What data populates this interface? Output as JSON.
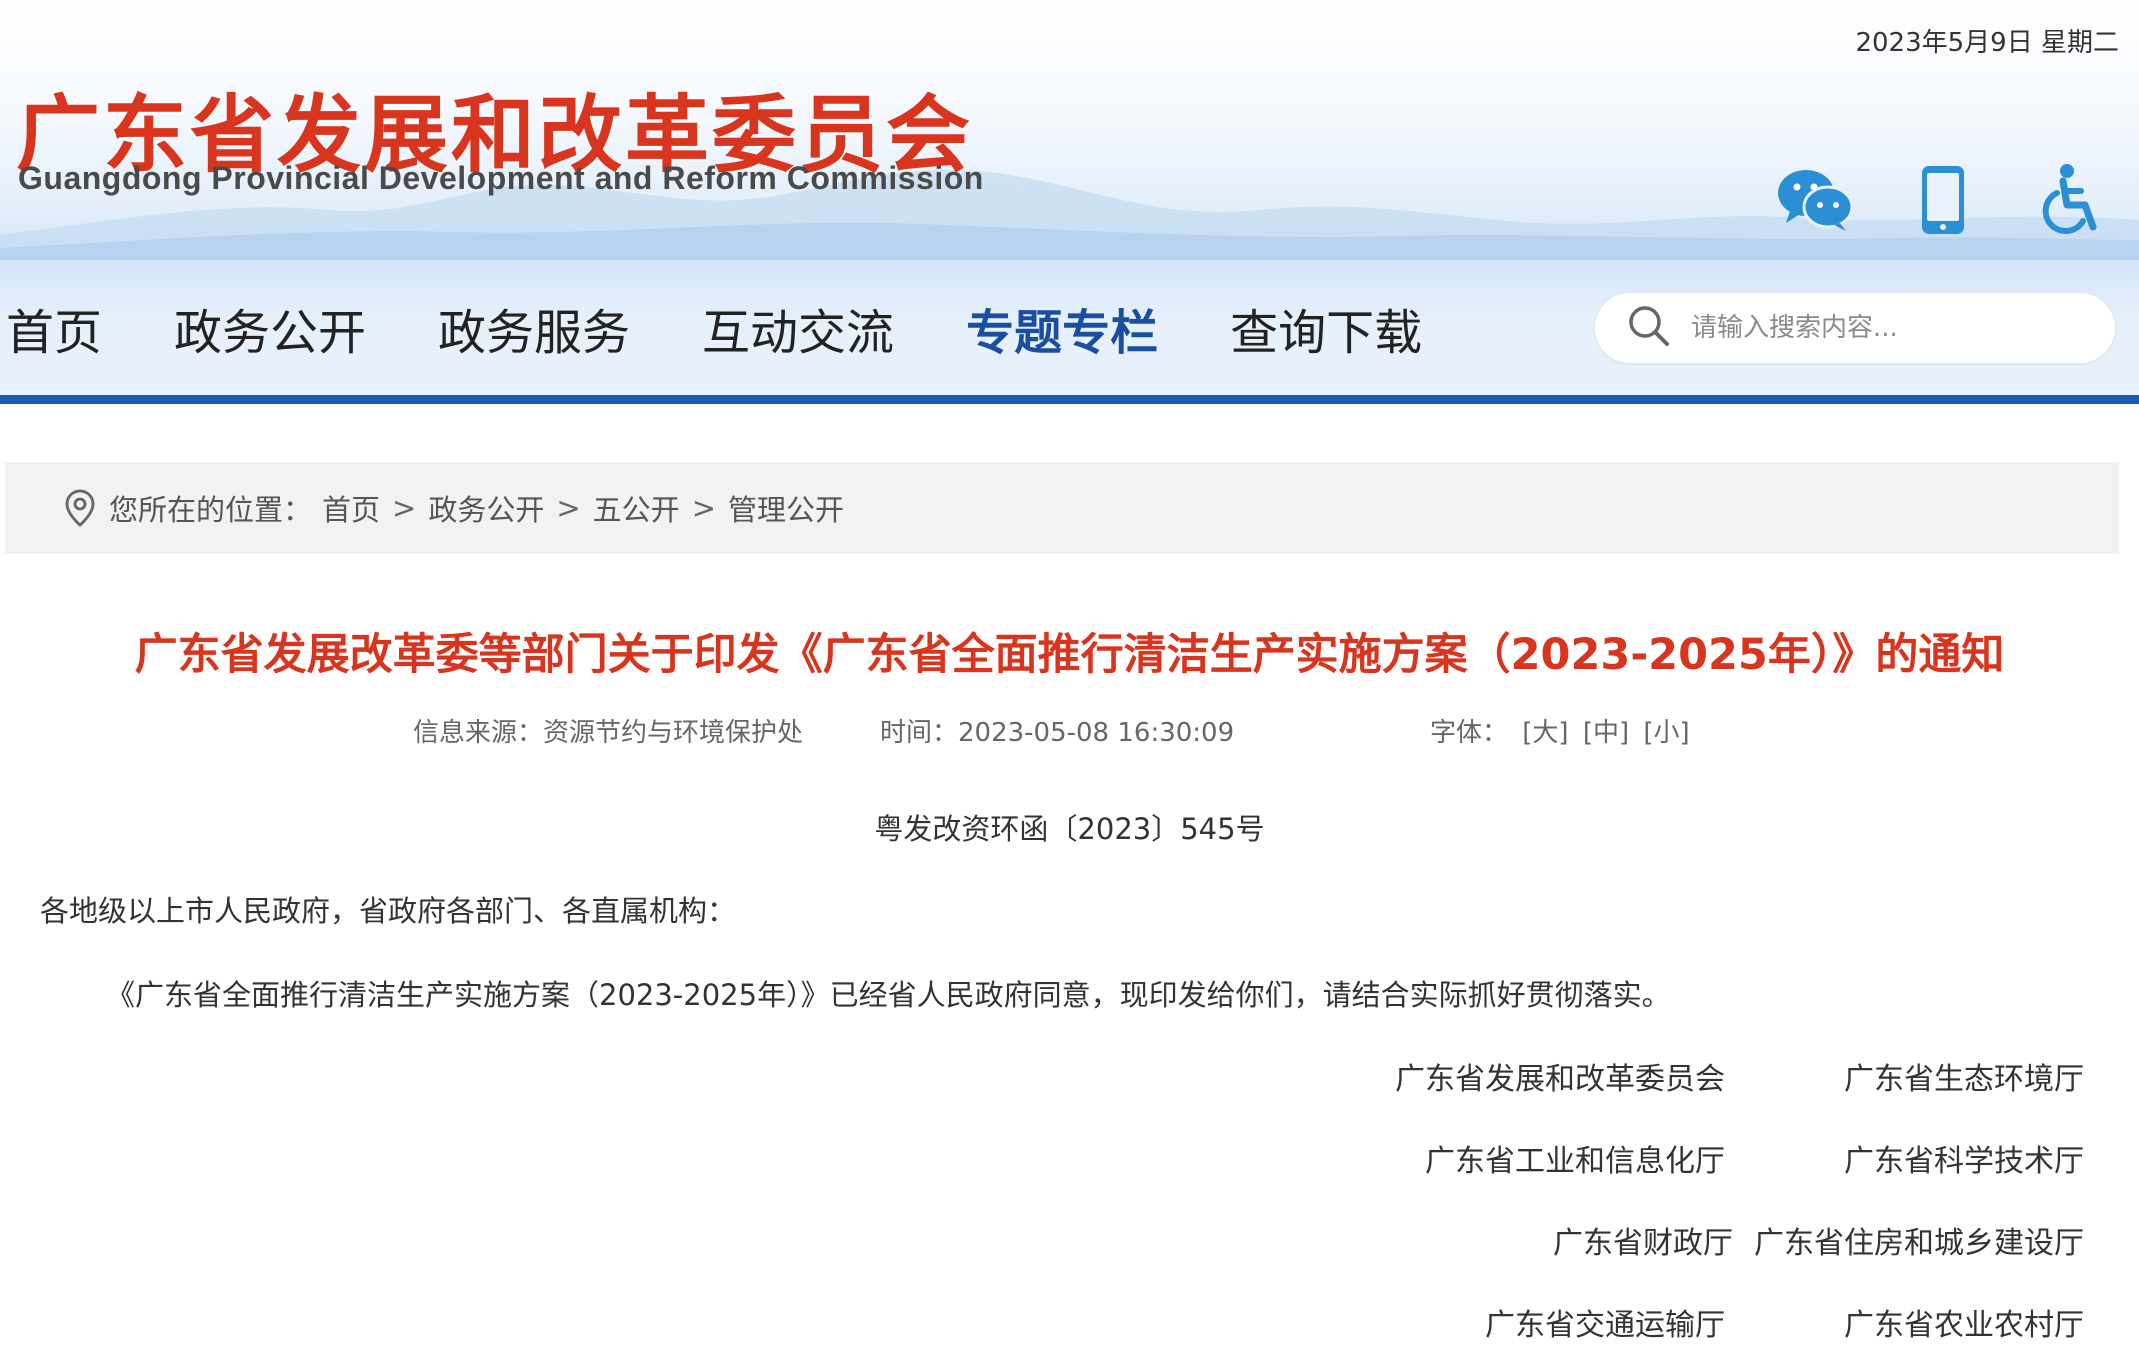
{
  "header": {
    "date": "2023年5月9日 星期二",
    "logo_cn": "广东省发展和改革委员会",
    "logo_en": "Guangdong Provincial Development and Reform Commission",
    "icons": [
      "wechat-icon",
      "mobile-icon",
      "accessibility-icon"
    ],
    "brand_red": "#d9341d",
    "brand_blue": "#1a5bb3"
  },
  "nav": {
    "items": [
      "首页",
      "政务公开",
      "政务服务",
      "互动交流",
      "专题专栏",
      "查询下载"
    ],
    "active": "专题专栏"
  },
  "search": {
    "placeholder": "请输入搜索内容..."
  },
  "breadcrumb": {
    "label": "您所在的位置：",
    "items": [
      "首页",
      "政务公开",
      "五公开",
      "管理公开"
    ],
    "separator": ">"
  },
  "article": {
    "title": "广东省发展改革委等部门关于印发《广东省全面推行清洁生产实施方案（2023-2025年）》的通知",
    "source": "信息来源：资源节约与环境保护处",
    "time": "时间：2023-05-08 16:30:09",
    "font_label": "字体：",
    "font_sizes": [
      "[大]",
      "[中]",
      "[小]"
    ],
    "doc_number": "粤发改资环函〔2023〕545号",
    "salutation": "各地级以上市人民政府，省政府各部门、各直属机构：",
    "body": "《广东省全面推行清洁生产实施方案（2023-2025年）》已经省人民政府同意，现印发给你们，请结合实际抓好贯彻落实。",
    "signatories": [
      [
        "广东省发展和改革委员会",
        "广东省生态环境厅"
      ],
      [
        "广东省工业和信息化厅",
        "广东省科学技术厅"
      ],
      [
        "广东省财政厅",
        "广东省住房和城乡建设厅"
      ],
      [
        "广东省交通运输厅",
        "广东省农业农村厅"
      ]
    ]
  }
}
